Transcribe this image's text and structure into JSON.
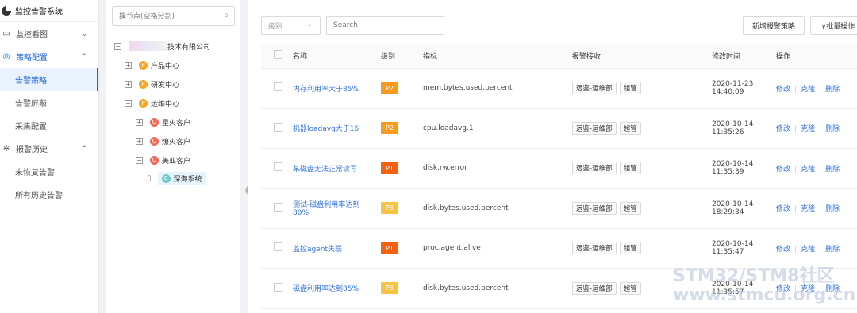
{
  "app": {
    "title": "监控告警系统"
  },
  "sidebar": {
    "groups": [
      {
        "label": "监控看图",
        "arrow": "⌄"
      },
      {
        "label": "策略配置",
        "arrow": "⌃"
      },
      {
        "label": "报警历史",
        "arrow": "⌃"
      }
    ],
    "items": [
      {
        "label": "告警策略"
      },
      {
        "label": "告警屏蔽"
      },
      {
        "label": "采集配置"
      },
      {
        "label": "未恢复告警"
      },
      {
        "label": "所有历史告警"
      }
    ]
  },
  "tree": {
    "search_placeholder": "搜节点(空格分割)",
    "root": {
      "toggle": "−",
      "label": "技术有限公司"
    },
    "nodes": [
      {
        "toggle": "+",
        "badge": "P",
        "label": "产品中心"
      },
      {
        "toggle": "+",
        "badge": "P",
        "label": "研发中心"
      },
      {
        "toggle": "−",
        "badge": "P",
        "label": "运维中心"
      },
      {
        "toggle": "+",
        "badge": "O",
        "label": "星火客户"
      },
      {
        "toggle": "+",
        "badge": "O",
        "label": "燎火客户"
      },
      {
        "toggle": "−",
        "badge": "O",
        "label": "美亚客户"
      },
      {
        "badge": "C",
        "label": "深海系统"
      }
    ],
    "collapse_handle": "《"
  },
  "toolbar": {
    "level_placeholder": "级别",
    "search_placeholder": "Search",
    "new_button": "新增报警策略",
    "batch_button": "∨批量操作"
  },
  "table": {
    "headers": [
      "名称",
      "级别",
      "指标",
      "报警接收",
      "修改时间",
      "操作"
    ],
    "rows": [
      {
        "name": "内存利用率大于85%",
        "level": "P2",
        "metric": "mem.bytes.used.percent",
        "receivers": [
          "远鉴-运维部",
          "超管"
        ],
        "time": "2020-11-23",
        "time2": "14:40:09"
      },
      {
        "name": "机器loadavg大于16",
        "level": "P2",
        "metric": "cpu.loadavg.1",
        "receivers": [
          "远鉴-运维部",
          "超管"
        ],
        "time": "2020-10-14",
        "time2": "11:35:26"
      },
      {
        "name": "某磁盘无法正常读写",
        "level": "P1",
        "metric": "disk.rw.error",
        "receivers": [
          "远鉴-运维部",
          "超管"
        ],
        "time": "2020-10-14",
        "time2": "11:35:39"
      },
      {
        "name": "测试-磁盘利用率达到",
        "name2": "80%",
        "level": "P3",
        "metric": "disk.bytes.used.percent",
        "receivers": [
          "远鉴-运维部",
          "超管"
        ],
        "time": "2020-10-14",
        "time2": "18:29:34"
      },
      {
        "name": "监控agent失联",
        "level": "P1",
        "metric": "proc.agent.alive",
        "receivers": [
          "远鉴-运维部",
          "超管"
        ],
        "time": "2020-10-14",
        "time2": "11:35:47"
      },
      {
        "name": "磁盘利用率达到85%",
        "level": "P3",
        "metric": "disk.bytes.used.percent",
        "receivers": [
          "远鉴-运维部",
          "超管"
        ],
        "time": "2020-10-14",
        "time2": "11:35:57"
      }
    ],
    "ops": [
      "修改",
      "克隆",
      "删除"
    ]
  },
  "colors": {
    "P1": "#f5620f",
    "P2": "#f79a1e",
    "P3": "#f5c242",
    "primary": "#1f66d8"
  },
  "watermark": {
    "line1": "STM32/STM8社区",
    "line2": "www.stmcu.org.cn"
  }
}
